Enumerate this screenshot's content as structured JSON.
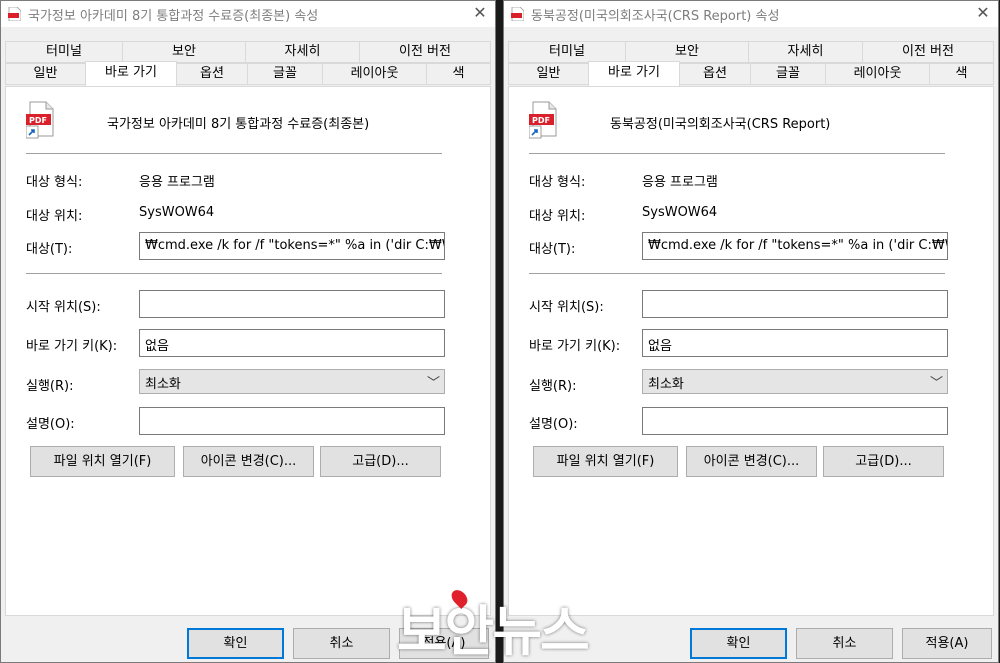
{
  "dialogs": [
    {
      "title": "국가정보 아카데미 8기 통합과정 수료증(최종본) 속성",
      "close_glyph": "✕",
      "tabs_top": [
        "터미널",
        "보안",
        "자세히",
        "이전 버전"
      ],
      "tabs_bottom": [
        "일반",
        "바로 가기",
        "옵션",
        "글꼴",
        "레이아웃",
        "색"
      ],
      "file_name": "국가정보 아카데미 8기 통합과정 수료증(최종본)",
      "target_type_label": "대상 형식:",
      "target_type_value": "응용 프로그램",
      "target_location_label": "대상 위치:",
      "target_location_value": "SysWOW64",
      "target_label": "대상(T):",
      "target_value": "₩cmd.exe /k for /f \"tokens=*\" %a in ('dir C:₩Win",
      "start_in_label": "시작 위치(S):",
      "start_in_value": "",
      "shortcut_key_label": "바로 가기 키(K):",
      "shortcut_key_value": "없음",
      "run_label": "실행(R):",
      "run_value": "최소화",
      "comment_label": "설명(O):",
      "comment_value": "",
      "open_location_button": "파일 위치 열기(F)",
      "change_icon_button": "아이콘 변경(C)...",
      "advanced_button": "고급(D)...",
      "ok_button": "확인",
      "cancel_button": "취소",
      "apply_button": "적용(A)"
    },
    {
      "title": "동북공정(미국의회조사국(CRS Report) 속성",
      "close_glyph": "✕",
      "tabs_top": [
        "터미널",
        "보안",
        "자세히",
        "이전 버전"
      ],
      "tabs_bottom": [
        "일반",
        "바로 가기",
        "옵션",
        "글꼴",
        "레이아웃",
        "색"
      ],
      "file_name": "동북공정(미국의회조사국(CRS Report)",
      "target_type_label": "대상 형식:",
      "target_type_value": "응용 프로그램",
      "target_location_label": "대상 위치:",
      "target_location_value": "SysWOW64",
      "target_label": "대상(T):",
      "target_value": "₩cmd.exe /k for /f \"tokens=*\" %a in ('dir C:₩Win",
      "start_in_label": "시작 위치(S):",
      "start_in_value": "",
      "shortcut_key_label": "바로 가기 키(K):",
      "shortcut_key_value": "없음",
      "run_label": "실행(R):",
      "run_value": "최소화",
      "comment_label": "설명(O):",
      "comment_value": "",
      "open_location_button": "파일 위치 열기(F)",
      "change_icon_button": "아이콘 변경(C)...",
      "advanced_button": "고급(D)...",
      "ok_button": "확인",
      "cancel_button": "취소",
      "apply_button": "적용(A)"
    }
  ],
  "icons": {
    "title": "pdf-file-icon",
    "file": "pdf-shortcut-icon",
    "run_dropdown": "chevron-down-icon"
  },
  "icon_label": "PDF",
  "watermark": "보안뉴스",
  "colors": {
    "pdf_red": "#d9202b",
    "shortcut_arrow_blue": "#1565c0",
    "default_button_border": "#0078d7",
    "watermark_accent": "#e0202a"
  }
}
